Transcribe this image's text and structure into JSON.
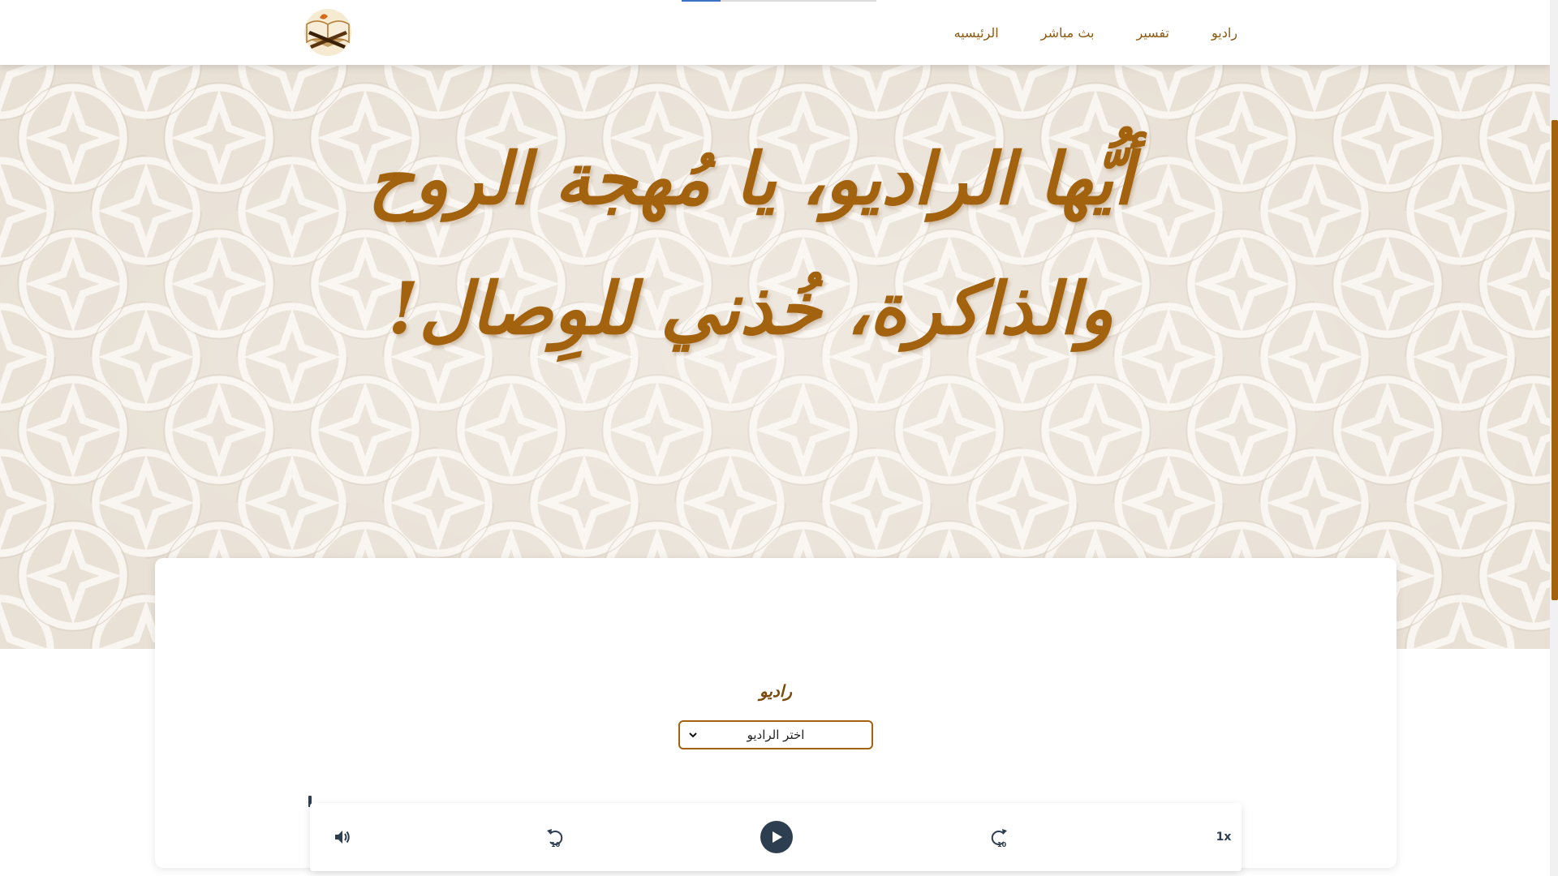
{
  "nav": {
    "links": [
      "راديو",
      "تفسير",
      "بث مباشر",
      "الرئيسيه"
    ],
    "logo_icon": "quran-book-logo"
  },
  "hero": {
    "line1": "أيُّها الراديو، يا مُهجة الروح",
    "line2": "والذاكرة، خُذني للوِصال!"
  },
  "radio": {
    "title": "راديو",
    "select_value": "اختر الراديو"
  },
  "player": {
    "speed_label": "1x",
    "rewind_seconds": "10",
    "forward_seconds": "10",
    "icons": [
      "volume-icon",
      "rewind-10-icon",
      "play-icon",
      "forward-10-icon"
    ],
    "progress": 0
  },
  "colors": {
    "accent": "#a2620e",
    "hero_bg": "#e9e1d6",
    "player_dark": "#2d3e50",
    "nav_text": "#8a5a12"
  }
}
